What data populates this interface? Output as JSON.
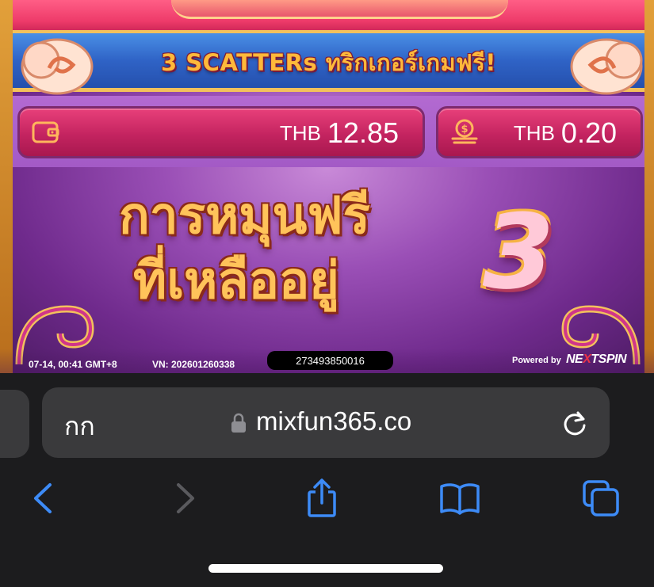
{
  "game": {
    "banner_text": "3 SCATTERs ทริกเกอร์เกมฟรี!",
    "balance": {
      "currency": "THB",
      "amount": "12.85",
      "icon": "wallet-icon"
    },
    "bet": {
      "currency": "THB",
      "amount": "0.20",
      "icon": "coin-stack-icon"
    },
    "free_spins_label_line1": "การหมุนฟรี",
    "free_spins_label_line2": "ที่เหลืออยู่",
    "free_spins_count": "3",
    "footer": {
      "datetime": "07-14, 00:41 GMT+8",
      "version": "VN: 202601260338",
      "round_id": "273493850016",
      "powered_by": "Powered by",
      "brand_pre": "NE",
      "brand_x": "X",
      "brand_post": "TSPIN"
    }
  },
  "browser": {
    "text_size_button": "กก",
    "url": "mixfun365.co",
    "icons": [
      "lock-icon",
      "reload-icon",
      "back-icon",
      "forward-icon",
      "share-icon",
      "bookmarks-icon",
      "tabs-icon"
    ]
  },
  "colors": {
    "accent_blue": "#3d8bf7",
    "disabled_gray": "#5a5a5e",
    "game_gold": "#ffc35a"
  }
}
